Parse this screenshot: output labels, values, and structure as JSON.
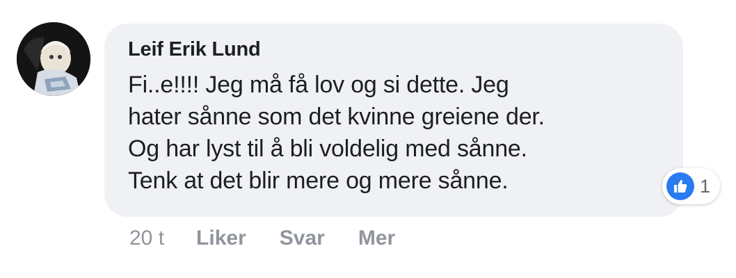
{
  "comment": {
    "author": "Leif Erik Lund",
    "text": "Fi..e!!!! Jeg må få lov og si dette. Jeg\nhater sånne som det kvinne greiene der.\nOg har lyst til å bli voldelig med sånne.\nTenk at det blir mere og mere sånne.",
    "reaction_icon": "like-icon",
    "reaction_count": "1"
  },
  "meta": {
    "time": "20 t",
    "like_label": "Liker",
    "reply_label": "Svar",
    "more_label": "Mer"
  },
  "colors": {
    "bubble": "#f0f1f4",
    "like_blue": "#2b7bf0",
    "meta_text": "#90949c"
  }
}
